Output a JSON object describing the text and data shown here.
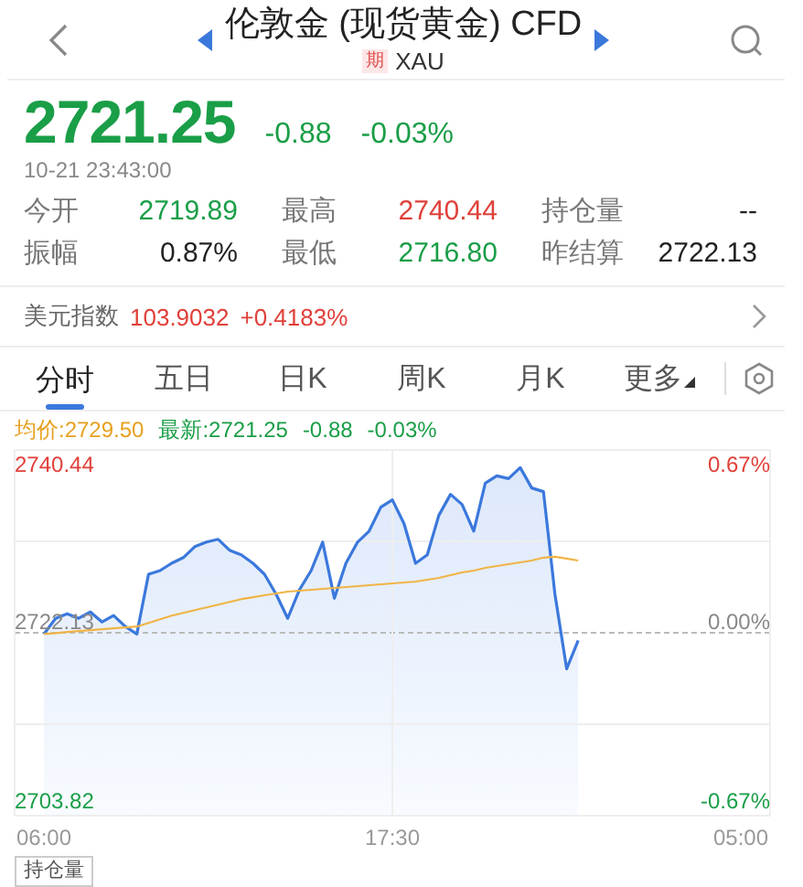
{
  "header": {
    "title": "伦敦金 (现货黄金) CFD",
    "badge": "期",
    "symbol": "XAU"
  },
  "quote": {
    "price": "2721.25",
    "change": "-0.88",
    "change_pct": "-0.03%",
    "color": "#1a9e47",
    "time": "10-21 23:43:00"
  },
  "stats": [
    {
      "label": "今开",
      "value": "2719.89",
      "color": "#1a9e47"
    },
    {
      "label": "最高",
      "value": "2740.44",
      "color": "#e0403a"
    },
    {
      "label": "持仓量",
      "value": "--",
      "color": "#222222"
    },
    {
      "label": "振幅",
      "value": "0.87%",
      "color": "#222222"
    },
    {
      "label": "最低",
      "value": "2716.80",
      "color": "#1a9e47"
    },
    {
      "label": "昨结算",
      "value": "2722.13",
      "color": "#222222"
    }
  ],
  "index_row": {
    "label": "美元指数",
    "value": "103.9032",
    "change": "+0.4183%",
    "color": "#e0403a"
  },
  "tabs": [
    {
      "label": "分时",
      "kind": "tab",
      "selected": true
    },
    {
      "label": "五日",
      "kind": "tab",
      "selected": false
    },
    {
      "label": "日K",
      "kind": "tab",
      "selected": false
    },
    {
      "label": "周K",
      "kind": "tab",
      "selected": false
    },
    {
      "label": "月K",
      "kind": "tab",
      "selected": false
    },
    {
      "label": "更多",
      "kind": "menu",
      "selected": false
    }
  ],
  "legend": {
    "average": "均价:2729.50",
    "latest": "最新:2721.25",
    "change": "-0.88",
    "change_pct": "-0.03%"
  },
  "chart": {
    "right_labels": [
      "0.67%",
      "0.00%",
      "-0.67%"
    ],
    "chart_data": {
      "type": "line",
      "categories": [
        "06:00",
        null,
        null,
        null,
        null,
        null,
        null,
        null,
        null,
        null,
        null,
        null,
        null,
        null,
        null,
        null,
        null,
        null,
        null,
        null,
        null,
        null,
        null,
        null,
        null,
        null,
        null,
        null,
        null,
        null,
        "17:30",
        null,
        null,
        null,
        null,
        null,
        null,
        null,
        null,
        null,
        null,
        null,
        null,
        null,
        null,
        null,
        null,
        null,
        null,
        null,
        null,
        null,
        null,
        null,
        null,
        null,
        null,
        null,
        null,
        null,
        "05:00"
      ],
      "series": [
        {
          "color": "#3b78dc",
          "values": [
            2722.0,
            2723.7,
            2724.2,
            2723.7,
            2724.4,
            2723.3,
            2724.0,
            2722.8,
            2722.0,
            2728.5,
            2728.9,
            2729.7,
            2730.3,
            2731.5,
            2732.0,
            2732.3,
            2731.1,
            2730.6,
            2729.7,
            2728.5,
            2726.3,
            2723.7,
            2726.8,
            2728.9,
            2732.0,
            2725.9,
            2729.7,
            2732.0,
            2733.2,
            2735.8,
            2736.6,
            2734.0,
            2729.7,
            2730.6,
            2734.9,
            2737.2,
            2736.1,
            2733.2,
            2738.4,
            2739.2,
            2738.9,
            2740.1,
            2737.9,
            2737.5,
            2726.3,
            2718.2,
            2721.3,
            null,
            null,
            null,
            null,
            null,
            null,
            null,
            null,
            null,
            null,
            null,
            null,
            null,
            null
          ]
        },
        {
          "color": "#f0b446",
          "values": [
            2722.0,
            2722.1,
            2722.2,
            2722.3,
            2722.4,
            2722.5,
            2722.6,
            2722.7,
            2722.8,
            2723.2,
            2723.6,
            2724.0,
            2724.3,
            2724.6,
            2724.9,
            2725.2,
            2725.5,
            2725.8,
            2726.0,
            2726.2,
            2726.4,
            2726.6,
            2726.7,
            2726.8,
            2726.9,
            2727.0,
            2727.1,
            2727.2,
            2727.3,
            2727.4,
            2727.5,
            2727.6,
            2727.7,
            2727.9,
            2728.1,
            2728.4,
            2728.7,
            2728.9,
            2729.2,
            2729.4,
            2729.6,
            2729.8,
            2730.0,
            2730.3,
            2730.4,
            2730.2,
            2730.0,
            null,
            null,
            null,
            null,
            null,
            null,
            null,
            null,
            null,
            null,
            null,
            null,
            null,
            null
          ]
        }
      ],
      "ylim": [
        2702.23,
        2742.03
      ],
      "yticks": [
        {
          "value": 2740.44,
          "label": "2740.44"
        },
        {
          "value": 2722.13,
          "label": "2722.13"
        },
        {
          "value": 2703.82,
          "label": "2703.82"
        }
      ]
    }
  },
  "bottom_tab": "持仓量"
}
